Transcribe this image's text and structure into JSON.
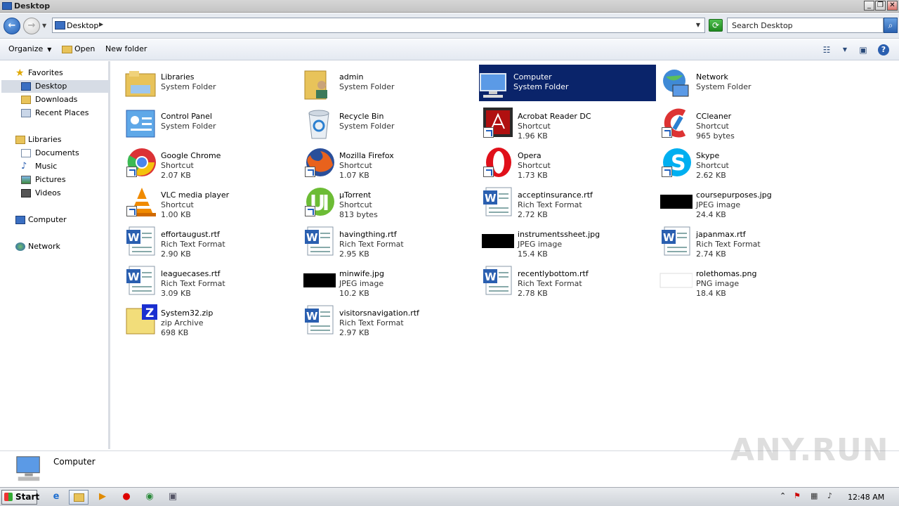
{
  "window": {
    "title": "Desktop",
    "min": "_",
    "max": "❐",
    "close": "✕"
  },
  "address": {
    "crumb": "Desktop",
    "search_placeholder": "Search Desktop"
  },
  "toolbar": {
    "organize": "Organize",
    "open": "Open",
    "new_folder": "New folder",
    "help": "?"
  },
  "nav": {
    "favorites": "Favorites",
    "desktop": "Desktop",
    "downloads": "Downloads",
    "recent": "Recent Places",
    "libraries": "Libraries",
    "documents": "Documents",
    "music": "Music",
    "pictures": "Pictures",
    "videos": "Videos",
    "computer": "Computer",
    "network": "Network"
  },
  "items": [
    {
      "name": "Libraries",
      "type": "System Folder",
      "size": ""
    },
    {
      "name": "admin",
      "type": "System Folder",
      "size": ""
    },
    {
      "name": "Computer",
      "type": "System Folder",
      "size": ""
    },
    {
      "name": "Network",
      "type": "System Folder",
      "size": ""
    },
    {
      "name": "Control Panel",
      "type": "System Folder",
      "size": ""
    },
    {
      "name": "Recycle Bin",
      "type": "System Folder",
      "size": ""
    },
    {
      "name": "Acrobat Reader DC",
      "type": "Shortcut",
      "size": "1.96 KB"
    },
    {
      "name": "CCleaner",
      "type": "Shortcut",
      "size": "965 bytes"
    },
    {
      "name": "Google Chrome",
      "type": "Shortcut",
      "size": "2.07 KB"
    },
    {
      "name": "Mozilla Firefox",
      "type": "Shortcut",
      "size": "1.07 KB"
    },
    {
      "name": "Opera",
      "type": "Shortcut",
      "size": "1.73 KB"
    },
    {
      "name": "Skype",
      "type": "Shortcut",
      "size": "2.62 KB"
    },
    {
      "name": "VLC media player",
      "type": "Shortcut",
      "size": "1.00 KB"
    },
    {
      "name": "µTorrent",
      "type": "Shortcut",
      "size": "813 bytes"
    },
    {
      "name": "acceptinsurance.rtf",
      "type": "Rich Text Format",
      "size": "2.72 KB"
    },
    {
      "name": "coursepurposes.jpg",
      "type": "JPEG image",
      "size": "24.4 KB"
    },
    {
      "name": "effortaugust.rtf",
      "type": "Rich Text Format",
      "size": "2.90 KB"
    },
    {
      "name": "havingthing.rtf",
      "type": "Rich Text Format",
      "size": "2.95 KB"
    },
    {
      "name": "instrumentssheet.jpg",
      "type": "JPEG image",
      "size": "15.4 KB"
    },
    {
      "name": "japanmax.rtf",
      "type": "Rich Text Format",
      "size": "2.74 KB"
    },
    {
      "name": "leaguecases.rtf",
      "type": "Rich Text Format",
      "size": "3.09 KB"
    },
    {
      "name": "minwife.jpg",
      "type": "JPEG image",
      "size": "10.2 KB"
    },
    {
      "name": "recentlybottom.rtf",
      "type": "Rich Text Format",
      "size": "2.78 KB"
    },
    {
      "name": "rolethomas.png",
      "type": "PNG image",
      "size": "18.4 KB"
    },
    {
      "name": "System32.zip",
      "type": "zip Archive",
      "size": "698 KB"
    },
    {
      "name": "visitorsnavigation.rtf",
      "type": "Rich Text Format",
      "size": "2.97 KB"
    }
  ],
  "details": {
    "label": "Computer"
  },
  "watermark": "ANY.RUN",
  "taskbar": {
    "start": "Start",
    "clock": "12:48 AM"
  },
  "colors": {
    "selection": "#0a246a",
    "nav_selected": "#d6dce5"
  }
}
